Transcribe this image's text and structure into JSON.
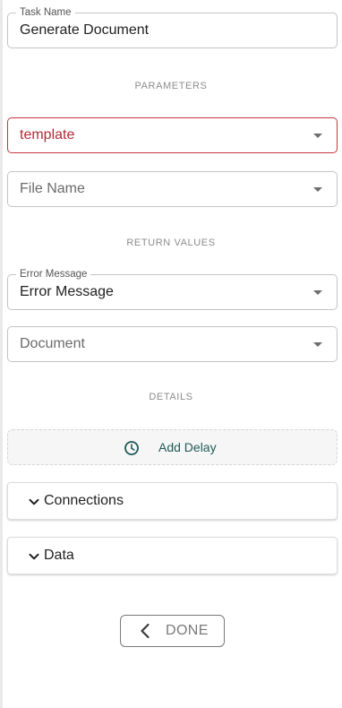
{
  "task_name": {
    "label": "Task Name",
    "value": "Generate Document"
  },
  "sections": {
    "parameters": "PARAMETERS",
    "return_values": "RETURN VALUES",
    "details": "DETAILS"
  },
  "parameters": {
    "template": {
      "placeholder": "template",
      "state": "error"
    },
    "file_name": {
      "placeholder": "File Name"
    }
  },
  "return_values": {
    "error_message": {
      "label": "Error Message",
      "value": "Error Message"
    },
    "document": {
      "placeholder": "Document"
    }
  },
  "details": {
    "add_delay_label": "Add Delay",
    "icon": "clock-icon"
  },
  "accordions": [
    {
      "label": "Connections",
      "icon": "chevron-down-icon"
    },
    {
      "label": "Data",
      "icon": "chevron-down-icon"
    }
  ],
  "done": {
    "label": "DONE",
    "icon": "chevron-left-icon"
  },
  "colors": {
    "error": "#c6363f",
    "accent": "#1e5a57",
    "muted": "#8c8c8c"
  }
}
